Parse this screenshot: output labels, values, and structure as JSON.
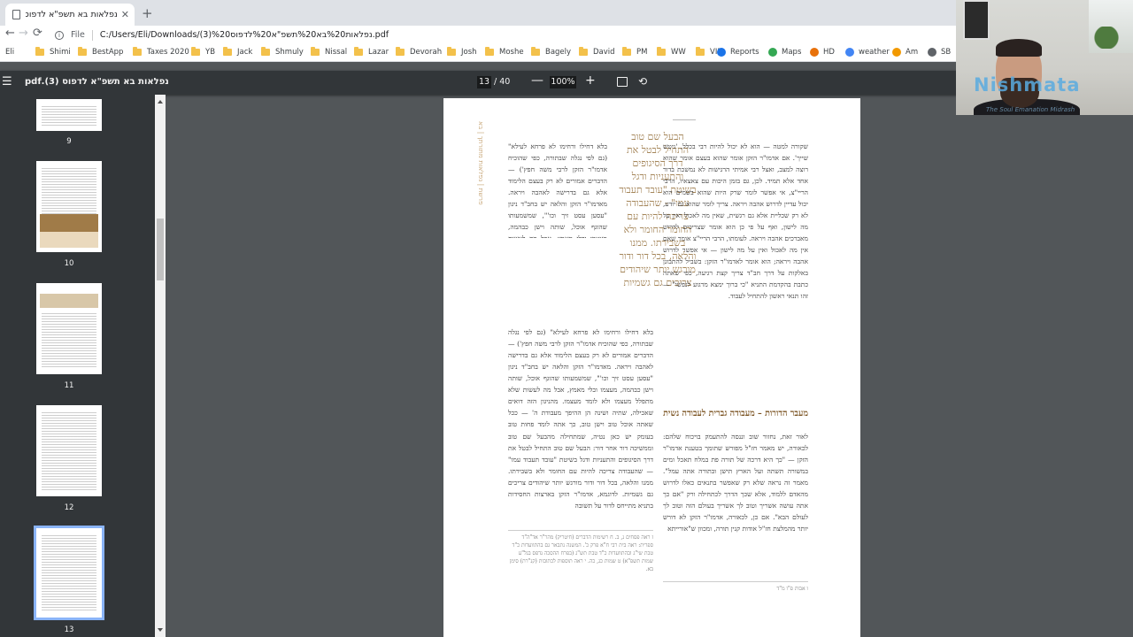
{
  "browser": {
    "tab_title": "נפלאות בא תשפ\"א לדפוס (3).pdf",
    "tab_close": "✕",
    "new_tab": "+",
    "back": "←",
    "forward": "→",
    "reload": "⟳",
    "scheme_label": "File",
    "url": "C:/Users/Eli/Downloads/(3)%20נפלאות%20בא%20תשפ\"א%20לדפוס.pdf"
  },
  "bookmarks": [
    {
      "label": "Eli",
      "type": "plain"
    },
    {
      "label": "Shimi",
      "type": "folder"
    },
    {
      "label": "BestApp",
      "type": "folder"
    },
    {
      "label": "Taxes 2020",
      "type": "folder"
    },
    {
      "label": "YB",
      "type": "folder"
    },
    {
      "label": "Jack",
      "type": "folder"
    },
    {
      "label": "Shmuly",
      "type": "folder"
    },
    {
      "label": "Nissal",
      "type": "folder"
    },
    {
      "label": "Lazar",
      "type": "folder"
    },
    {
      "label": "Devorah",
      "type": "folder"
    },
    {
      "label": "Josh",
      "type": "folder"
    },
    {
      "label": "Moshe",
      "type": "folder"
    },
    {
      "label": "Bagely",
      "type": "folder"
    },
    {
      "label": "David",
      "type": "folder"
    },
    {
      "label": "PM",
      "type": "folder"
    },
    {
      "label": "WW",
      "type": "folder"
    },
    {
      "label": "VIP",
      "type": "folder"
    },
    {
      "label": "Reports",
      "type": "fav",
      "color": "#1a73e8"
    },
    {
      "label": "Maps",
      "type": "fav",
      "color": "#34a853"
    },
    {
      "label": "HD",
      "type": "fav",
      "color": "#e8710a"
    },
    {
      "label": "weather",
      "type": "fav",
      "color": "#4285f4"
    },
    {
      "label": "Am",
      "type": "fav",
      "color": "#f29900"
    },
    {
      "label": "SB",
      "type": "fav",
      "color": "#5f6368"
    }
  ],
  "pdf": {
    "title": "נפלאות בא תשפ\"א לדפוס (3).pdf",
    "current_page": "13",
    "page_count": "/ 40",
    "zoom": "100%",
    "menu_icon": "☰",
    "zoom_out": "—",
    "zoom_in": "+",
    "rotate": "⟲"
  },
  "thumbnails": [
    {
      "label": "9"
    },
    {
      "label": "10"
    },
    {
      "label": "11"
    },
    {
      "label": "12"
    },
    {
      "label": "13"
    }
  ],
  "page": {
    "running_head": "פרשת | נפלאות מתורתך | בא",
    "pull_quote": "הבעל שם טוב התחיל לבטל את דרך הסיגופים והתעניות ודגל בשיטת \"עובד תעבוד עמו\" - שהעבודה צריכה להיות עם החומר החומר ולא בשבירתו. ממנו והלאה, בכל דור ודור מורגש יותר שיהודים צריכים גם גשמיות",
    "right_column": "שקורה למטה — הוא לא יכול להיות רבי בכלל, 'ניטש שייך'. אם אדמו\"ר הזקן אומר שהוא בעצם אומר שהוא רוצה למצב, ואצל רבי אמיתי הרגישות לא נמשכת בדור אחד אלא תמיד. לכן, גם בזמן היכות עם צאצאיו, הרבי הריי\"צ, אי אפשר לומר שרק היות שהוא בשמים הוא יכול עדיין לדרוש אהבה ויראה. צריך לומר שהוא גם יודע, לא רק שכליית אלא גם רגשית, שאין מה לאכול ואין על מה לישון, ואף על פי כן הוא אומר שצריכים לדרוש מאברכים אהבה ויראה. לעומתו, הרבי הריי\"צ אומר שאם אין מה לאכול ואין על מה לישון — אי אפשר לדרוש אהבה ויראה; הוא אומר לאדמו\"ר הזקן: בשביל להתבונן באלקות על דרך חב\"ד צריך קצת רגיעה, כפי שאתה כתבת בהקדמת התניא \"כי ברוך ימצא מרגוע לנפשו\" — זהו תנאי ראשון להתחיל לעבוד.",
    "heading": "מעבר הדורות – מעבודה גברית לעבודה נשית",
    "right_column_2": "לאור זאת, נחזור שוב וננסה להתעמק בויכוח שלהם: לכאורה, יש מאמר חז\"ל מפורש שתומך בטענת אדמו\"ר הזקן — \"כך היא דרכה של תורה פת במלח תאכל ומים במשורה תשתה ועל הארץ תישן ובתורה אתה עמל\". מאמר זה נראה שלא רק שאפשר בתנאים כאלו לדרוש מהאדם ללמוד, אלא שכך הדרך לכתחילה ורק \"אם כך אתה עושה אשריך וטוב לך אשריך בעולם הזה וטוב לך לעולם הבא\". אם כן, לכאורה, אדמו\"ר הזקן לא דורש יותר מהמלצת חז\"ל אודות קנין תורה, ומכוון ש\"אורייתא",
    "left_column": "בלא דחילו ורחימו לא פרחא לעילא\" (גם לפי נגלה שבתורה, כפי שהוכיח אדמו\"ר הזקן לרבי משה חפץ') — הדברים אמורים לא רק בעצם הלימוד אלא גם בדרישה לאהבה ויראה. מאדמו\"ר הזקן והלאה יש בחב\"ד ניגון \"עסען עסט זיך וכו'\", שמשמעותו שהוגף אוכל, שותה וישן כבהמה, מעצמו ובלי מאמץ, אבל מה לעשות שלא מתפלל מעצמו ולא לומד מעצמו. מהניגון הזה דואים שאכילה, שתיה ושינה הן ההיפך מעבודת ה' — ככל שאתה אוכל טוב וישן טוב, כך אתה לומד פחות טוב ומתפלל פחות טוב. ממש כמו \"כך היא דרכה של תורה וכו'\" — אם לא תלך בדרך הזו לא תזכה לכתר תורה אף פעם, אין סיכוי. בכל אופן הרבי הריי\"צ הוא הנשיא בדורו. עם כל גדולת אדמו\"ר הזקן, ועם כל בטולו של הרבי הריי\"צ אליו, את ההחלטות צריך לקבל הרבי הנוכחי — והוא אומר שאי אפשר לדרוש אהבה ויראה. כיצד דבריו מתיישבים עם המשנה בפרקי אבות?",
    "left_column_2": "בעומק יש כאן נטיה, שמתחילה מהבעל שם טוב וממשיכה דור אחר דור: הבעל שם טוב התחיל לבטל את דרך הסיגופים והתעניות ודגל בשיטת \"עובד תעבוד עמו\" — שהעבודה צריכה להיות עם החומר ולא בשבירתו. ממנו והלאה, בכל דור ודור מורגש יותר שיהודים צריכים גם גשמיות. לדוגמא, אדמו\"ר הזקן בארצות החסידות בתניא מתייחס לדור על תשובה",
    "footnotes_left": "ז ראה פסחים נ, ב. ח רשימות הדברים (חיטריק) מהר\"ר אד\"ה\"ד ספרית: ראה בית רבי ח\"א פרק כ'. המשנה נתבאר גם בהתוועדות כ\"ד טבת שי\"ג ובהתוועדות כ\"ד טבת תש\"ג (בפרח ההסכה נדפס בגל\"ע שמות תשפ\"א) ט שמות כג, כה. י ראה תוספות לכתובות (קנ\"רת) סימן בא.",
    "footnotes_right": "ו אבות פ\"ו מ\"ד"
  },
  "overlay": {
    "logo": "Nishmata",
    "tagline": "The Soul Emanation Midrash"
  }
}
